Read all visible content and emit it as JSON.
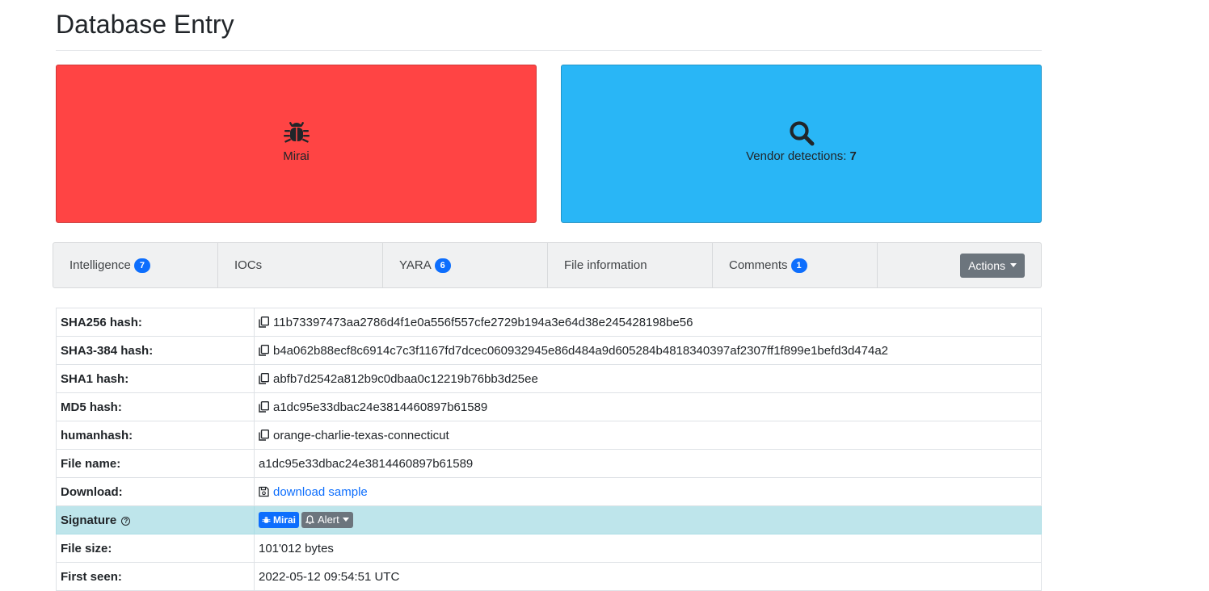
{
  "page": {
    "title": "Database Entry"
  },
  "cards": {
    "malware": {
      "label": "Mirai",
      "icon": "bug-icon",
      "color": "#ff4444"
    },
    "vendor": {
      "label": "Vendor detections: ",
      "count": "7",
      "icon": "search-icon",
      "color": "#29b6f6"
    }
  },
  "tabs": [
    {
      "label": "Intelligence",
      "badge": "7"
    },
    {
      "label": "IOCs"
    },
    {
      "label": "YARA",
      "badge": "6"
    },
    {
      "label": "File information"
    },
    {
      "label": "Comments",
      "badge": "1"
    }
  ],
  "actions": {
    "label": "Actions"
  },
  "details": {
    "sha256": {
      "key": "SHA256 hash:",
      "value": "11b73397473aa2786d4f1e0a556f557cfe2729b194a3e64d38e245428198be56"
    },
    "sha3": {
      "key": "SHA3-384 hash:",
      "value": "b4a062b88ecf8c6914c7c3f1167fd7dcec060932945e86d484a9d605284b4818340397af2307ff1f899e1befd3d474a2"
    },
    "sha1": {
      "key": "SHA1 hash:",
      "value": "abfb7d2542a812b9c0dbaa0c12219b76bb3d25ee"
    },
    "md5": {
      "key": "MD5 hash:",
      "value": "a1dc95e33dbac24e3814460897b61589"
    },
    "humanhash": {
      "key": "humanhash:",
      "value": "orange-charlie-texas-connecticut"
    },
    "filename": {
      "key": "File name:",
      "value": "a1dc95e33dbac24e3814460897b61589"
    },
    "download": {
      "key": "Download:",
      "value": "download sample"
    },
    "signature": {
      "key": "Signature",
      "value": "Mirai",
      "alert": "Alert"
    },
    "filesize": {
      "key": "File size:",
      "value": "101'012 bytes"
    },
    "firstseen": {
      "key": "First seen:",
      "value": "2022-05-12 09:54:51 UTC"
    }
  }
}
